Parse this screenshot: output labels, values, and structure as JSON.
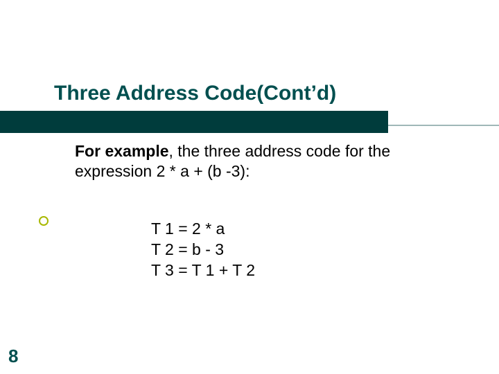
{
  "title": "Three Address Code(Cont’d)",
  "intro": {
    "lead": "For example",
    "rest": ", the three address code for the expression 2 * a + (b -3):"
  },
  "code": {
    "l1": "T 1 = 2 * a",
    "l2": "T 2 = b - 3",
    "l3": "T 3 = T 1 + T 2"
  },
  "page_number": "8"
}
